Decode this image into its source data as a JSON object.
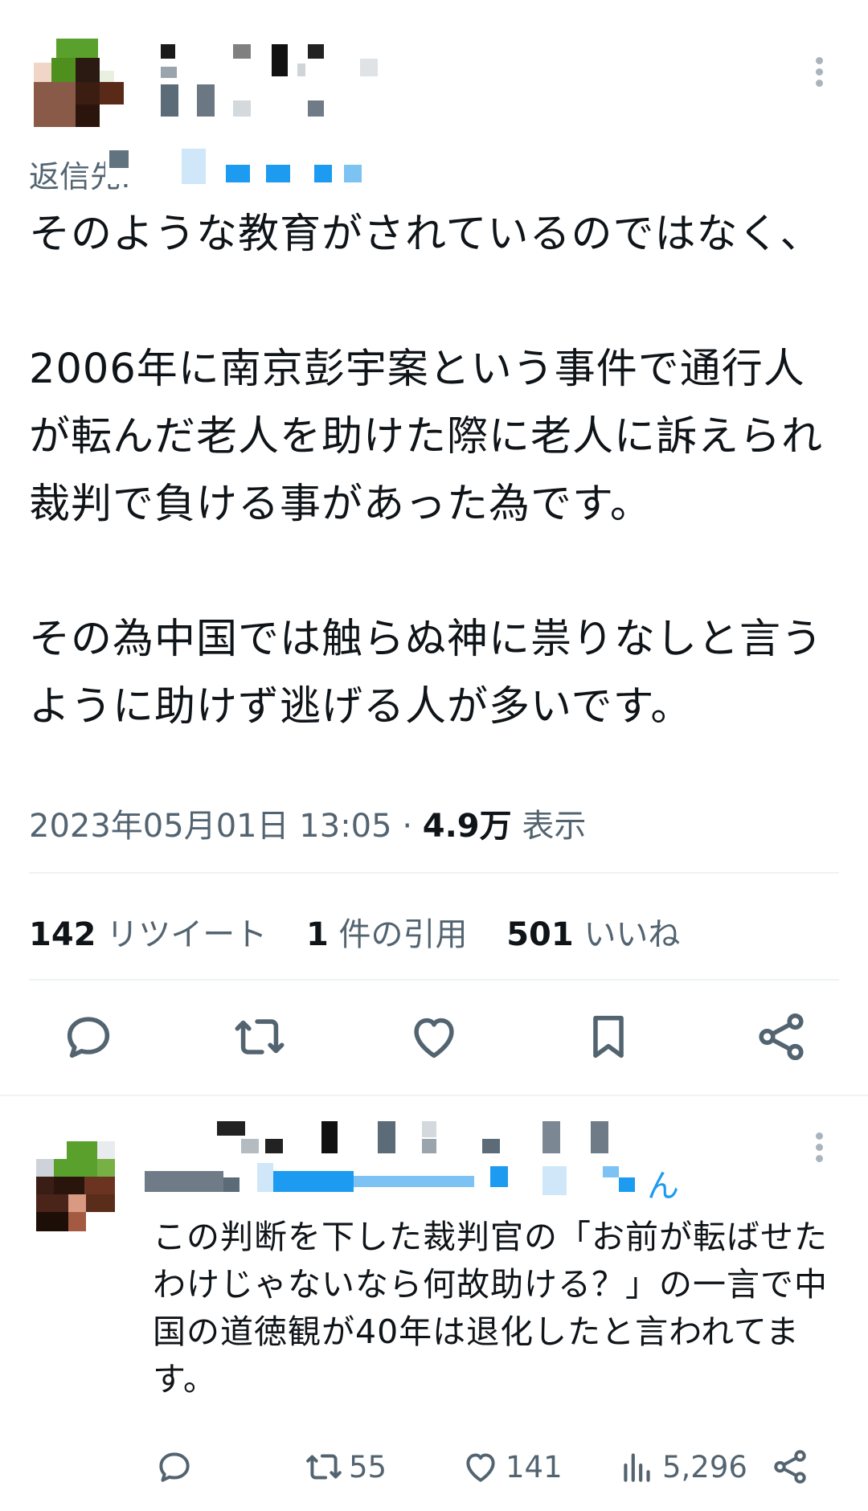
{
  "main_tweet": {
    "reply_to_label": "返信先:",
    "body": "そのような教育がされているのではなく、\n\n2006年に南京彭宇案という事件で通行人が転んだ老人を助けた際に老人に訴えられ裁判で負ける事があった為です。\n\nその為中国では触らぬ神に祟りなしと言うように助けず逃げる人が多いです。",
    "timestamp": "2023年05月01日 13:05",
    "separator": "·",
    "views_count": "4.9万",
    "views_label": "表示",
    "stats": {
      "retweets_count": "142",
      "retweets_label": "リツイート",
      "quotes_count": "1",
      "quotes_label": "件の引用",
      "likes_count": "501",
      "likes_label": "いいね"
    },
    "actions": {
      "reply_icon": "reply-icon",
      "retweet_icon": "retweet-icon",
      "like_icon": "heart-icon",
      "bookmark_icon": "bookmark-icon",
      "share_icon": "share-icon"
    }
  },
  "reply_tweet": {
    "handle_suffix": "ん",
    "body": "この判断を下した裁判官の「お前が転ばせたわけじゃないなら何故助ける？」の一言で中国の道徳観が40年は退化したと言われてます。",
    "retweets": "55",
    "likes": "141",
    "views": "5,296"
  },
  "colors": {
    "text": "#0f1419",
    "secondary": "#536471",
    "accent": "#1d9bf0",
    "divider": "#eff3f4"
  }
}
